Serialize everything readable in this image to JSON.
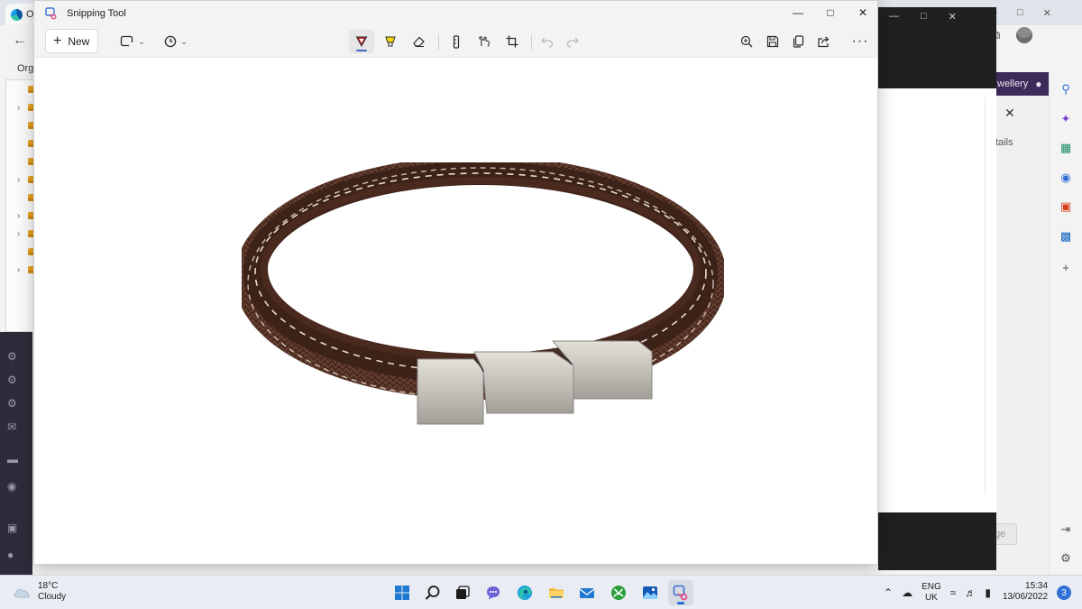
{
  "background_browser": {
    "tab_title": "Or",
    "favorites_label": "Org",
    "purple_bar_text": "wellery",
    "details_label": "tails",
    "page_button_label": "ge",
    "favorite_rows": [
      {
        "has_chevron": false
      },
      {
        "has_chevron": true
      },
      {
        "has_chevron": false
      },
      {
        "has_chevron": false
      },
      {
        "has_chevron": false
      },
      {
        "has_chevron": true
      },
      {
        "has_chevron": false
      },
      {
        "has_chevron": true
      },
      {
        "has_chevron": true
      },
      {
        "has_chevron": false
      },
      {
        "has_chevron": true
      }
    ],
    "sidebar_icons": [
      "search-icon",
      "copilot-icon",
      "shopping-icon",
      "games-icon",
      "office-icon",
      "outlook-icon",
      "add-icon"
    ]
  },
  "snipping_tool": {
    "title": "Snipping Tool",
    "new_label": "New",
    "toolbar_icons": {
      "mode": "snip-mode-icon",
      "delay": "delay-timer-icon",
      "pen": "ballpoint-pen-icon",
      "highlighter": "highlighter-icon",
      "eraser": "eraser-icon",
      "ruler": "ruler-icon",
      "touch": "touch-writing-icon",
      "crop": "crop-icon",
      "undo": "undo-icon",
      "redo": "redo-icon",
      "zoom": "zoom-icon",
      "save": "save-icon",
      "copy": "copy-icon",
      "share": "share-icon",
      "more": "more-icon"
    },
    "colors": {
      "pen_accent": "#c62828",
      "highlighter": "#f5d90a",
      "leather": "#4a2a1f",
      "stitch": "#e8dccf",
      "clasp": "#c4c1bb"
    }
  },
  "taskbar": {
    "weather_temp": "18°C",
    "weather_desc": "Cloudy",
    "apps": [
      "windows-start",
      "search",
      "task-view",
      "teams-chat",
      "edge",
      "file-explorer",
      "mail",
      "xbox",
      "photos",
      "snipping-tool"
    ],
    "active_app": "snipping-tool",
    "lang_line1": "ENG",
    "lang_line2": "UK",
    "time": "15:34",
    "date": "13/06/2022",
    "notification_count": "3"
  }
}
